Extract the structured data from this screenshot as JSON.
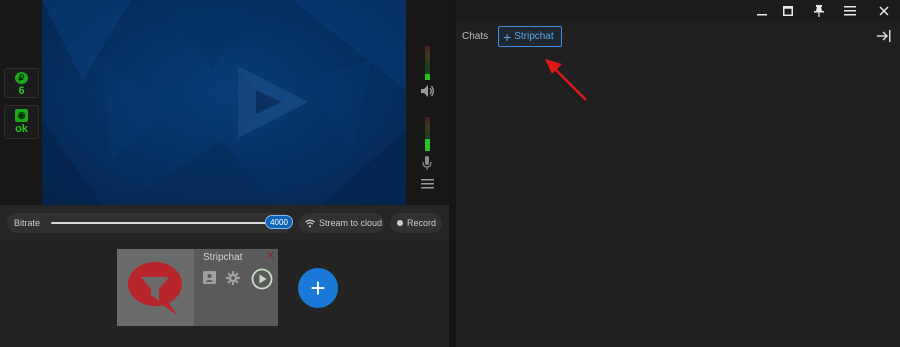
{
  "left_panel": {
    "stats": [
      {
        "icon": "coin-icon",
        "glyph": "₽",
        "value": "6"
      },
      {
        "icon": "camera-status-icon",
        "glyph": "◉",
        "value": "ok"
      }
    ],
    "controls": {
      "bitrate_label": "Bitrate",
      "bitrate_value": "4000",
      "stream_to_cloud_label": "Stream to cloud",
      "record_label": "Record"
    },
    "scenes": [
      {
        "name": "Stripchat"
      }
    ],
    "add_label": "+"
  },
  "right_panel": {
    "window_buttons": [
      "minimize",
      "maximize",
      "pin",
      "menu",
      "close"
    ],
    "chats_label": "Chats",
    "chat_tabs": [
      {
        "label": "Stripchat"
      }
    ]
  },
  "colors": {
    "accent": "#1a78d6",
    "status_green": "#27c227",
    "stripchat_red": "#d0191e",
    "annotation_red": "#e01818"
  }
}
